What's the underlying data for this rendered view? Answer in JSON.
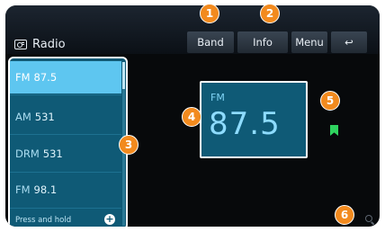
{
  "header": {
    "title": "Radio"
  },
  "buttons": {
    "band": "Band",
    "info": "Info",
    "menu": "Menu",
    "back": "↩"
  },
  "presets": [
    {
      "band": "FM",
      "freq": "87.5"
    },
    {
      "band": "AM",
      "freq": "531"
    },
    {
      "band": "DRM",
      "freq": "531"
    },
    {
      "band": "FM",
      "freq": "98.1"
    }
  ],
  "list": {
    "hold_text": "Press and hold",
    "add_symbol": "+"
  },
  "now_playing": {
    "band": "FM",
    "freq": "87.5"
  },
  "callouts": [
    "1",
    "2",
    "3",
    "4",
    "5",
    "6"
  ],
  "colors": {
    "accent": "#5ec6f0",
    "panel": "#0f5a76",
    "callout": "#f28a1e",
    "bookmark": "#2fd35f"
  }
}
